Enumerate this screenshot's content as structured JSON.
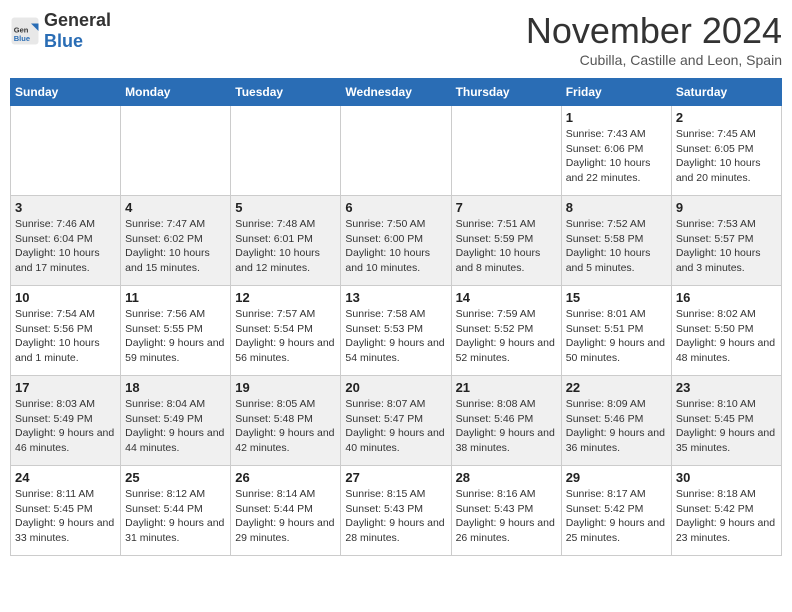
{
  "logo": {
    "general": "General",
    "blue": "Blue"
  },
  "header": {
    "month": "November 2024",
    "location": "Cubilla, Castille and Leon, Spain"
  },
  "days_of_week": [
    "Sunday",
    "Monday",
    "Tuesday",
    "Wednesday",
    "Thursday",
    "Friday",
    "Saturday"
  ],
  "weeks": [
    [
      {
        "day": "",
        "content": ""
      },
      {
        "day": "",
        "content": ""
      },
      {
        "day": "",
        "content": ""
      },
      {
        "day": "",
        "content": ""
      },
      {
        "day": "",
        "content": ""
      },
      {
        "day": "1",
        "content": "Sunrise: 7:43 AM\nSunset: 6:06 PM\nDaylight: 10 hours and 22 minutes."
      },
      {
        "day": "2",
        "content": "Sunrise: 7:45 AM\nSunset: 6:05 PM\nDaylight: 10 hours and 20 minutes."
      }
    ],
    [
      {
        "day": "3",
        "content": "Sunrise: 7:46 AM\nSunset: 6:04 PM\nDaylight: 10 hours and 17 minutes."
      },
      {
        "day": "4",
        "content": "Sunrise: 7:47 AM\nSunset: 6:02 PM\nDaylight: 10 hours and 15 minutes."
      },
      {
        "day": "5",
        "content": "Sunrise: 7:48 AM\nSunset: 6:01 PM\nDaylight: 10 hours and 12 minutes."
      },
      {
        "day": "6",
        "content": "Sunrise: 7:50 AM\nSunset: 6:00 PM\nDaylight: 10 hours and 10 minutes."
      },
      {
        "day": "7",
        "content": "Sunrise: 7:51 AM\nSunset: 5:59 PM\nDaylight: 10 hours and 8 minutes."
      },
      {
        "day": "8",
        "content": "Sunrise: 7:52 AM\nSunset: 5:58 PM\nDaylight: 10 hours and 5 minutes."
      },
      {
        "day": "9",
        "content": "Sunrise: 7:53 AM\nSunset: 5:57 PM\nDaylight: 10 hours and 3 minutes."
      }
    ],
    [
      {
        "day": "10",
        "content": "Sunrise: 7:54 AM\nSunset: 5:56 PM\nDaylight: 10 hours and 1 minute."
      },
      {
        "day": "11",
        "content": "Sunrise: 7:56 AM\nSunset: 5:55 PM\nDaylight: 9 hours and 59 minutes."
      },
      {
        "day": "12",
        "content": "Sunrise: 7:57 AM\nSunset: 5:54 PM\nDaylight: 9 hours and 56 minutes."
      },
      {
        "day": "13",
        "content": "Sunrise: 7:58 AM\nSunset: 5:53 PM\nDaylight: 9 hours and 54 minutes."
      },
      {
        "day": "14",
        "content": "Sunrise: 7:59 AM\nSunset: 5:52 PM\nDaylight: 9 hours and 52 minutes."
      },
      {
        "day": "15",
        "content": "Sunrise: 8:01 AM\nSunset: 5:51 PM\nDaylight: 9 hours and 50 minutes."
      },
      {
        "day": "16",
        "content": "Sunrise: 8:02 AM\nSunset: 5:50 PM\nDaylight: 9 hours and 48 minutes."
      }
    ],
    [
      {
        "day": "17",
        "content": "Sunrise: 8:03 AM\nSunset: 5:49 PM\nDaylight: 9 hours and 46 minutes."
      },
      {
        "day": "18",
        "content": "Sunrise: 8:04 AM\nSunset: 5:49 PM\nDaylight: 9 hours and 44 minutes."
      },
      {
        "day": "19",
        "content": "Sunrise: 8:05 AM\nSunset: 5:48 PM\nDaylight: 9 hours and 42 minutes."
      },
      {
        "day": "20",
        "content": "Sunrise: 8:07 AM\nSunset: 5:47 PM\nDaylight: 9 hours and 40 minutes."
      },
      {
        "day": "21",
        "content": "Sunrise: 8:08 AM\nSunset: 5:46 PM\nDaylight: 9 hours and 38 minutes."
      },
      {
        "day": "22",
        "content": "Sunrise: 8:09 AM\nSunset: 5:46 PM\nDaylight: 9 hours and 36 minutes."
      },
      {
        "day": "23",
        "content": "Sunrise: 8:10 AM\nSunset: 5:45 PM\nDaylight: 9 hours and 35 minutes."
      }
    ],
    [
      {
        "day": "24",
        "content": "Sunrise: 8:11 AM\nSunset: 5:45 PM\nDaylight: 9 hours and 33 minutes."
      },
      {
        "day": "25",
        "content": "Sunrise: 8:12 AM\nSunset: 5:44 PM\nDaylight: 9 hours and 31 minutes."
      },
      {
        "day": "26",
        "content": "Sunrise: 8:14 AM\nSunset: 5:44 PM\nDaylight: 9 hours and 29 minutes."
      },
      {
        "day": "27",
        "content": "Sunrise: 8:15 AM\nSunset: 5:43 PM\nDaylight: 9 hours and 28 minutes."
      },
      {
        "day": "28",
        "content": "Sunrise: 8:16 AM\nSunset: 5:43 PM\nDaylight: 9 hours and 26 minutes."
      },
      {
        "day": "29",
        "content": "Sunrise: 8:17 AM\nSunset: 5:42 PM\nDaylight: 9 hours and 25 minutes."
      },
      {
        "day": "30",
        "content": "Sunrise: 8:18 AM\nSunset: 5:42 PM\nDaylight: 9 hours and 23 minutes."
      }
    ]
  ]
}
